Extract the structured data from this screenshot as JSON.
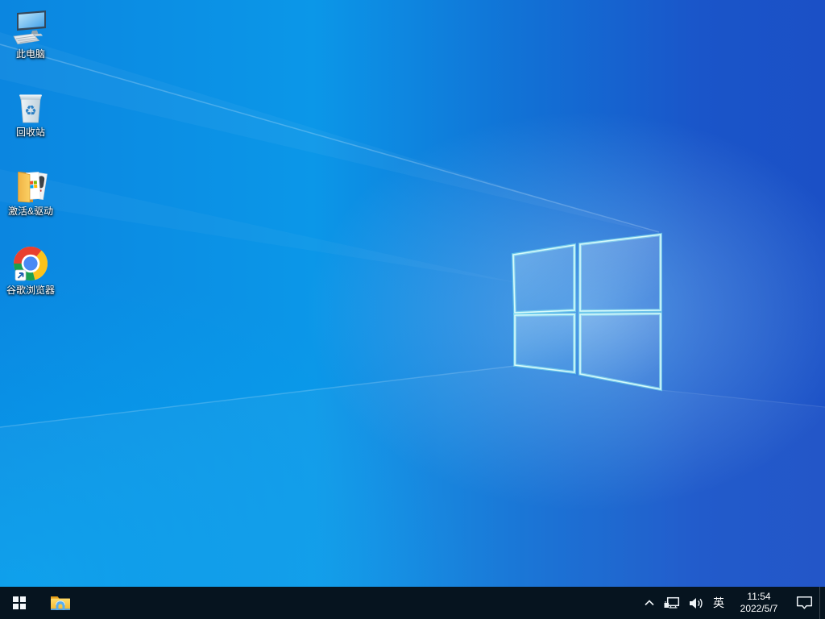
{
  "desktop": {
    "icons": [
      {
        "id": "this-pc",
        "label": "此电脑"
      },
      {
        "id": "recycle-bin",
        "label": "回收站"
      },
      {
        "id": "activation-drivers",
        "label": "激活&驱动"
      },
      {
        "id": "google-chrome",
        "label": "谷歌浏览器"
      }
    ],
    "wallpaper": {
      "style": "windows-10-hero-light-rays",
      "left_color": "#0b86e0",
      "bottom_left_color": "#03a9f0",
      "right_color": "#1b50c6",
      "logo_glow_color": "#9fdcff",
      "logo_edge_color": "#8beef2"
    }
  },
  "taskbar": {
    "background_color": "#06141f",
    "tray": {
      "ime_indicator": "英",
      "time": "11:54",
      "date": "2022/5/7"
    }
  }
}
